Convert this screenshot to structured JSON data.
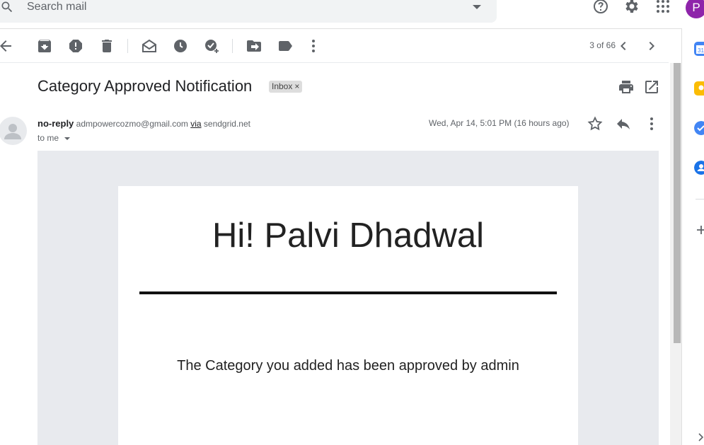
{
  "search": {
    "placeholder": "Search mail"
  },
  "account": {
    "avatar_letter": "P"
  },
  "pager": {
    "text": "3 of 66"
  },
  "message": {
    "subject": "Category Approved Notification",
    "label": "Inbox",
    "label_remove": "×",
    "sender_name": "no-reply",
    "sender_email": "admpowercozmo@gmail.com",
    "via": "via",
    "via_domain": "sendgrid.net",
    "to": "to me",
    "date": "Wed, Apr 14, 5:01 PM (16 hours ago)"
  },
  "email_body": {
    "greeting": "Hi! Palvi Dhadwal",
    "text": "The Category you added has been approved by admin"
  },
  "colors": {
    "avatar": "#8e24aa",
    "email_background": "#e8eaee",
    "icon": "#5f6368"
  },
  "icons": [
    "search-icon",
    "help-icon",
    "settings-icon",
    "apps-icon",
    "back-icon",
    "archive-icon",
    "report-spam-icon",
    "delete-icon",
    "mark-unread-icon",
    "snooze-icon",
    "add-task-icon",
    "move-to-icon",
    "label-icon",
    "more-icon",
    "prev-icon",
    "next-icon",
    "print-icon",
    "open-new-window-icon",
    "star-icon",
    "reply-icon",
    "calendar-icon",
    "keep-icon",
    "tasks-icon",
    "contacts-icon",
    "add-icon"
  ]
}
